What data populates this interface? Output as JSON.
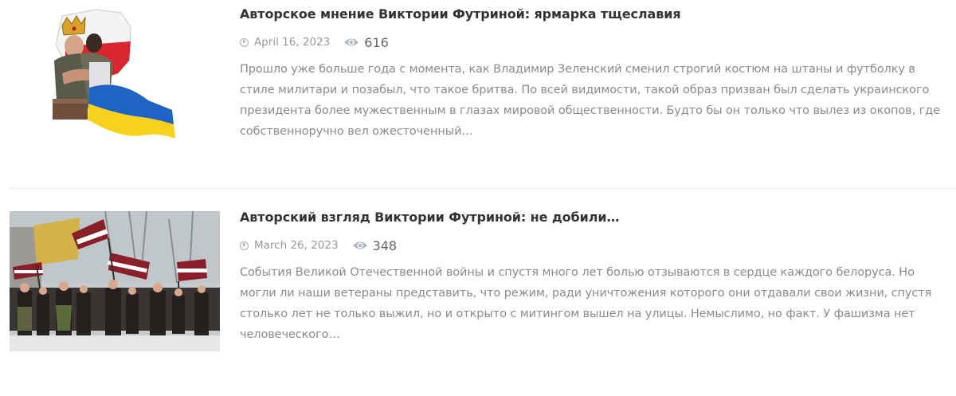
{
  "posts": [
    {
      "title": "Авторское мнение Виктории Футриной: ярмарка тщеславия",
      "date": "April 16, 2023",
      "views": "616",
      "excerpt": "Прошло уже больше года с момента, как Владимир Зеленский сменил строгий костюм на штаны и футболку в стиле милитари и позабыл, что такое бритва. По всей видимости, такой образ призван был сделать украинского президента более мужественным в глазах мировой общественности. Будто бы он только что вылез из окопов, где собственноручно вел ожесточенный…",
      "thumbnail_icon": "collage-image"
    },
    {
      "title": "Авторский взгляд Виктории Футриной: не добили…",
      "date": "March 26, 2023",
      "views": "348",
      "excerpt": "События Великой Отечественной войны и спустя много лет болью отзываются в сердце каждого белоруса. Но могли ли наши ветераны представить, что режим, ради уничтожения которого они отдавали свои жизни, спустя столько лет не только выжил, но и открыто с митингом вышел на улицы. Немыслимо, но факт. У фашизма нет человеческого…",
      "thumbnail_icon": "march-photo"
    }
  ],
  "icons": {
    "date": "clock-icon",
    "views": "eye-icon"
  },
  "colors": {
    "title": "#333333",
    "meta": "#999999",
    "excerpt": "#8b8b8b",
    "divider": "#ececec"
  }
}
